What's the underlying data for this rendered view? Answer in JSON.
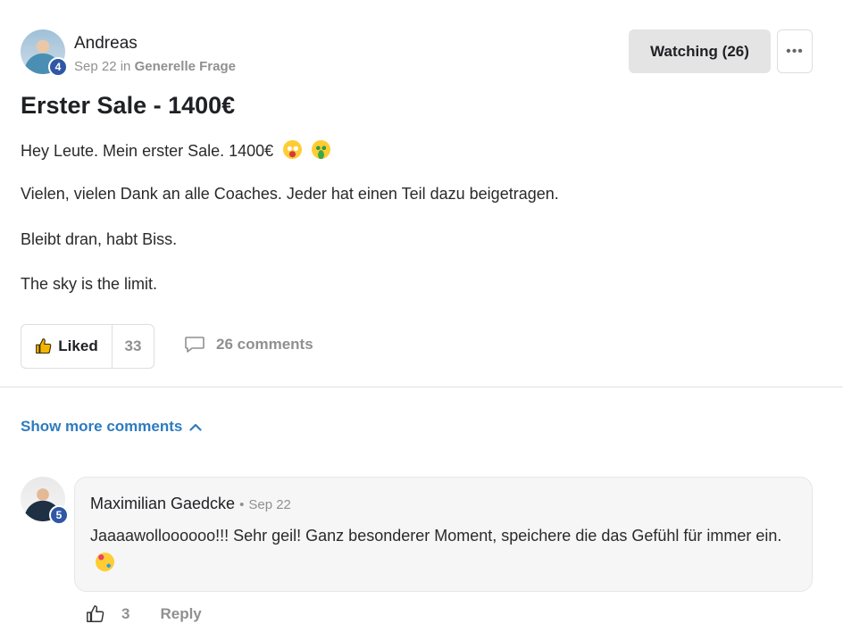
{
  "post": {
    "author": "Andreas",
    "author_level": "4",
    "date": "Sep 22",
    "in_word": "in",
    "category": "Generelle Frage",
    "watching_label": "Watching (26)",
    "more_label": "•••",
    "title": "Erster Sale - 1400€",
    "paragraphs": [
      "Hey Leute. Mein erster Sale. 1400€",
      "Vielen, vielen Dank an alle Coaches. Jeder hat einen Teil dazu beigetragen.",
      "Bleibt dran, habt Biss.",
      "The sky is the limit."
    ],
    "liked_label": "Liked",
    "like_count": "33",
    "comments_label": "26 comments"
  },
  "comments_section": {
    "show_more_label": "Show more comments"
  },
  "comment": {
    "author": "Maximilian Gaedcke",
    "author_level": "5",
    "separator": "•",
    "date": "Sep 22",
    "text": "Jaaaawolloooooo!!! Sehr geil! Ganz besonderer Moment, speichere die das Gefühl für immer ein.",
    "like_count": "3",
    "reply_label": "Reply"
  },
  "icons": {
    "like": "thumbs-up-icon",
    "comment": "speech-bubble-icon",
    "chevron": "chevron-up-icon",
    "emoji_1": "crazy-face-emoji",
    "emoji_2": "money-mouth-face-emoji",
    "emoji_3": "party-face-emoji"
  },
  "colors": {
    "accent_link": "#2e7bbf",
    "level_badge": "#2f57a5",
    "watch_button_bg": "#e4e4e4",
    "muted_text": "#909090"
  }
}
